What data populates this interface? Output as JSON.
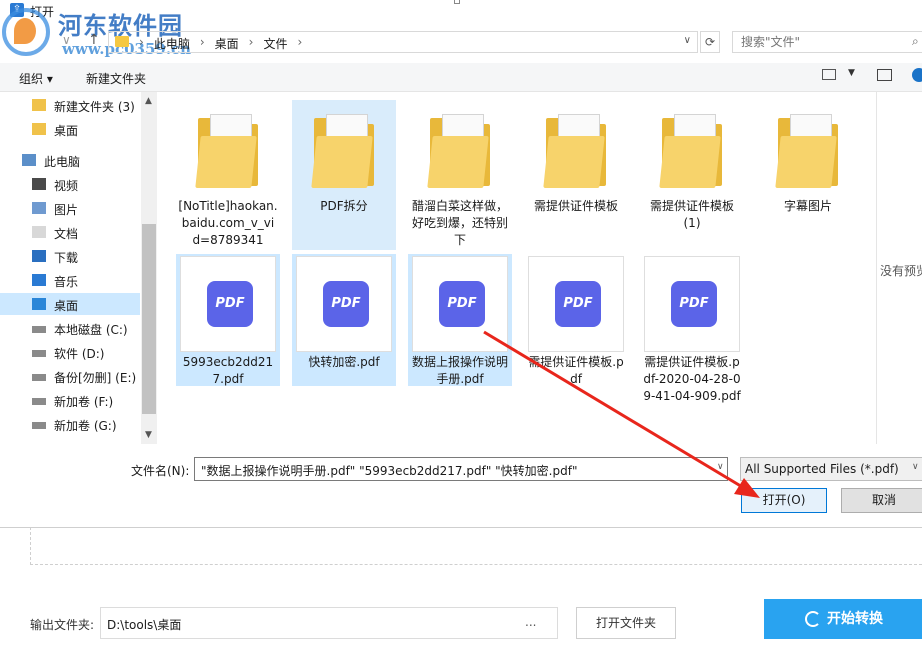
{
  "dialog": {
    "title": "打开",
    "watermark_text": "河东软件园",
    "watermark_url": "www.pc0359.cn",
    "address": {
      "crumbs": [
        "此电脑",
        "桌面",
        "文件"
      ],
      "search_placeholder": "搜索\"文件\""
    },
    "toolbar": {
      "organize_label": "组织 ▾",
      "new_folder_label": "新建文件夹"
    },
    "sidebar": {
      "items": [
        {
          "label": "新建文件夹 (3)",
          "icon": "folder-icon"
        },
        {
          "label": "桌面",
          "icon": "folder-icon"
        },
        {
          "label": "此电脑",
          "icon": "computer-icon"
        },
        {
          "label": "视频",
          "icon": "video-icon"
        },
        {
          "label": "图片",
          "icon": "pictures-icon"
        },
        {
          "label": "文档",
          "icon": "documents-icon"
        },
        {
          "label": "下载",
          "icon": "download-icon"
        },
        {
          "label": "音乐",
          "icon": "music-icon"
        },
        {
          "label": "桌面",
          "icon": "desktop-icon",
          "selected": true
        },
        {
          "label": "本地磁盘 (C:)",
          "icon": "drive-icon"
        },
        {
          "label": "软件 (D:)",
          "icon": "drive-icon"
        },
        {
          "label": "备份[勿删] (E:)",
          "icon": "drive-icon"
        },
        {
          "label": "新加卷 (F:)",
          "icon": "drive-icon"
        },
        {
          "label": "新加卷 (G:)",
          "icon": "drive-icon"
        }
      ]
    },
    "files": [
      {
        "name": "[NoTitle]haokan.baidu.com_v_vid=8789341",
        "type": "folder"
      },
      {
        "name": "PDF拆分",
        "type": "folder",
        "state": "hover"
      },
      {
        "name": "醋溜白菜这样做，好吃到爆，还特别下",
        "type": "folder"
      },
      {
        "name": "需提供证件模板",
        "type": "folder"
      },
      {
        "name": "需提供证件模板 (1)",
        "type": "folder"
      },
      {
        "name": "字幕图片",
        "type": "folder"
      },
      {
        "name": "5993ecb2dd217.pdf",
        "type": "pdf",
        "state": "selected"
      },
      {
        "name": "快转加密.pdf",
        "type": "pdf",
        "state": "selected"
      },
      {
        "name": "数据上报操作说明手册.pdf",
        "type": "pdf",
        "state": "selected"
      },
      {
        "name": "需提供证件模板.pdf",
        "type": "pdf"
      },
      {
        "name": "需提供证件模板.pdf-2020-04-28-09-41-04-909.pdf",
        "type": "pdf"
      }
    ],
    "pdf_badge": "PDF",
    "preview_text": "没有预览",
    "filename_label": "文件名(N):",
    "filename_value": "\"数据上报操作说明手册.pdf\" \"5993ecb2dd217.pdf\" \"快转加密.pdf\"",
    "filetype_value": "All Supported Files (*.pdf)",
    "open_label": "打开(O)",
    "cancel_label": "取消"
  },
  "app": {
    "output_label": "输出文件夹:",
    "output_path": "D:\\tools\\桌面",
    "browse_label": "...",
    "open_folder_label": "打开文件夹",
    "convert_label": "开始转换"
  },
  "colors": {
    "accent": "#29a3f0",
    "selection": "#cce8ff",
    "pdf_badge": "#5b64e8",
    "arrow": "#e8261c"
  }
}
